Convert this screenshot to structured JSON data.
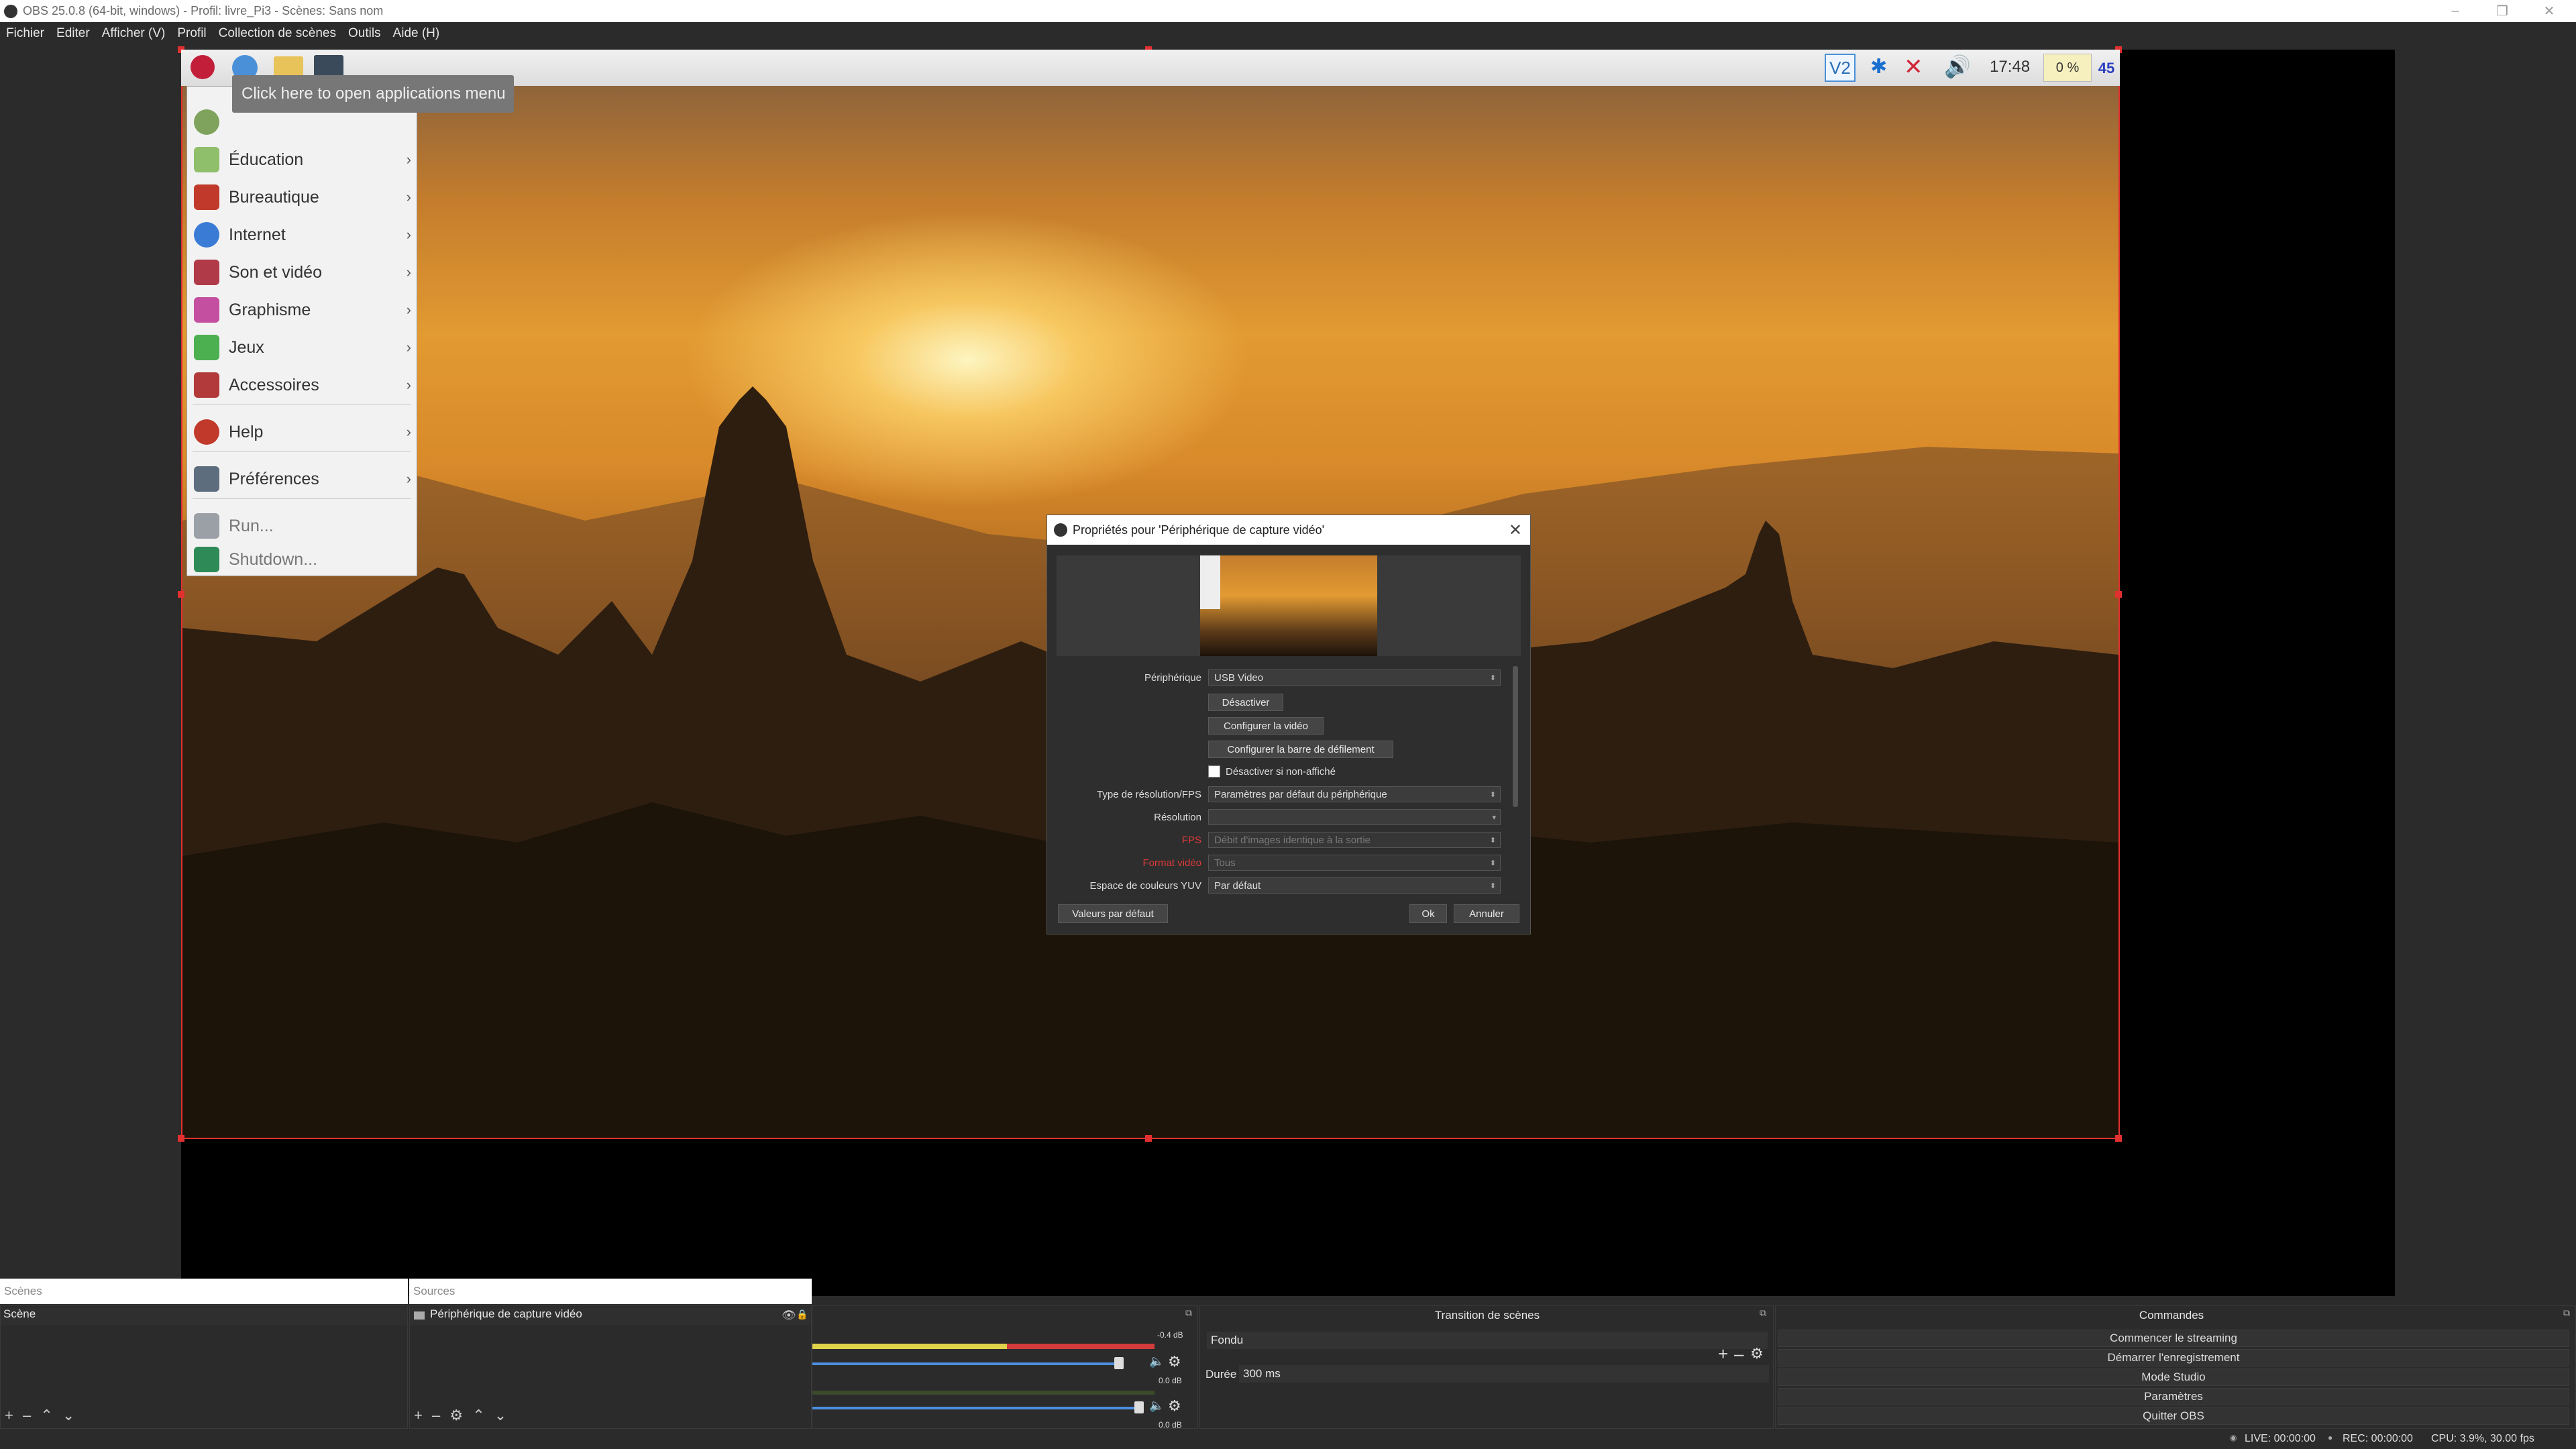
{
  "window": {
    "title": "OBS 25.0.8 (64-bit, windows) - Profil: livre_Pi3 - Scènes: Sans nom",
    "controls": [
      "–",
      "❐",
      "✕"
    ]
  },
  "menubar": [
    "Fichier",
    "Editer",
    "Afficher (V)",
    "Profil",
    "Collection de scènes",
    "Outils",
    "Aide (H)"
  ],
  "rpi_panel": {
    "tooltip": "Click here to open applications menu",
    "clock": "17:48",
    "cpu": "0 %",
    "temp": "45",
    "tray_vnc": "V2"
  },
  "app_menu": {
    "items": [
      {
        "label": "Éducation",
        "icon": "education-icon",
        "color": "#8fbf6a",
        "arrow": "›"
      },
      {
        "label": "Bureautique",
        "icon": "office-icon",
        "color": "#c0392b",
        "arrow": "›"
      },
      {
        "label": "Internet",
        "icon": "globe-icon",
        "color": "#3a7bd5",
        "arrow": "›"
      },
      {
        "label": "Son et vidéo",
        "icon": "sound-video-icon",
        "color": "#b03a48",
        "arrow": "›"
      },
      {
        "label": "Graphisme",
        "icon": "graphics-icon",
        "color": "#c44fa0",
        "arrow": "›"
      },
      {
        "label": "Jeux",
        "icon": "games-icon",
        "color": "#4caf50",
        "arrow": "›"
      },
      {
        "label": "Accessoires",
        "icon": "accessories-icon",
        "color": "#b23a3a",
        "arrow": "›"
      },
      {
        "label": "Help",
        "icon": "help-icon",
        "color": "#c0392b",
        "arrow": "›"
      },
      {
        "label": "Préférences",
        "icon": "preferences-icon",
        "color": "#5d6d7e",
        "arrow": "›"
      },
      {
        "label": "Run...",
        "icon": "run-icon",
        "color": "#9aa0a6",
        "arrow": ""
      },
      {
        "label": "Shutdown...",
        "icon": "shutdown-icon",
        "color": "#2e8b57",
        "arrow": ""
      }
    ]
  },
  "dialog": {
    "title": "Propriétés pour 'Périphérique de capture vidéo'",
    "rows": {
      "peripherique_label": "Périphérique",
      "peripherique_value": "USB Video",
      "desactiver_btn": "Désactiver",
      "configurer_video_btn": "Configurer la vidéo",
      "configurer_barre_btn": "Configurer la barre de défilement",
      "desactiver_check": "Désactiver si non-affiché",
      "type_res_label": "Type de résolution/FPS",
      "type_res_value": "Paramètres par défaut du périphérique",
      "resolution_label": "Résolution",
      "resolution_value": "",
      "fps_label": "FPS",
      "fps_value": "Débit d'images identique à la sortie",
      "format_label": "Format vidéo",
      "format_value": "Tous",
      "yuv_label": "Espace de couleurs YUV",
      "yuv_value": "Par défaut"
    },
    "defaults_btn": "Valeurs par défaut",
    "ok_btn": "Ok",
    "cancel_btn": "Annuler"
  },
  "docks": {
    "scenes_title": "Scènes",
    "scene_item": "Scène",
    "sources_title": "Sources",
    "source_item": "Périphérique de capture vidéo",
    "mixer": {
      "level1": "-0.4 dB",
      "level2": "0.0 dB",
      "level3": "0.0 dB"
    },
    "transition_title": "Transition de scènes",
    "transition_value": "Fondu",
    "duration_label": "Durée",
    "duration_value": "300 ms",
    "commands_title": "Commandes",
    "commands": [
      "Commencer le streaming",
      "Démarrer l'enregistrement",
      "Mode Studio",
      "Paramètres",
      "Quitter OBS"
    ]
  },
  "status": {
    "live": "LIVE: 00:00:00",
    "rec": "REC: 00:00:00",
    "cpu": "CPU: 3.9%, 30.00 fps"
  }
}
